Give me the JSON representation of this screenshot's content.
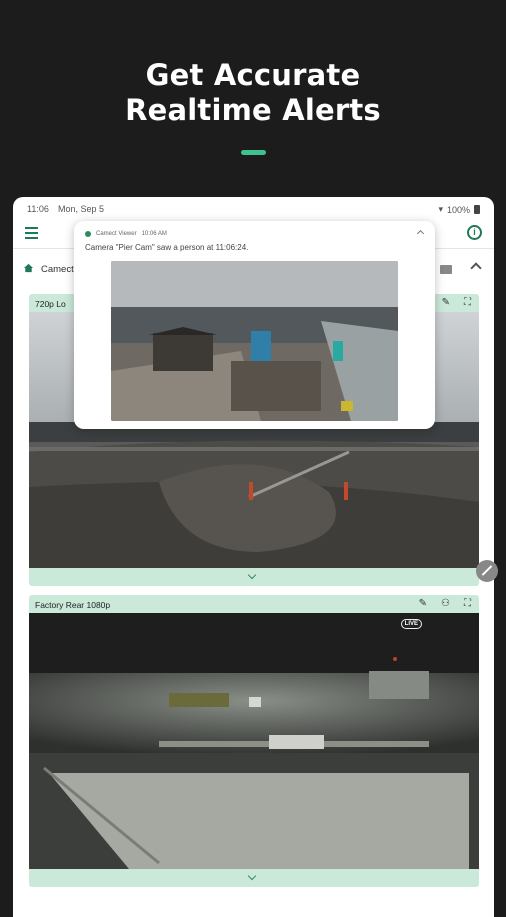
{
  "promo": {
    "headline_line1": "Get Accurate",
    "headline_line2": "Realtime Alerts",
    "accent_color": "#3ec28f"
  },
  "statusbar": {
    "time": "11:06",
    "date": "Mon, Sep 5",
    "battery": "100%"
  },
  "appbar": {
    "menu_icon": "hamburger-menu-icon",
    "info_icon": "info-icon"
  },
  "location": {
    "label": "Camect",
    "home_icon": "home-icon"
  },
  "notification": {
    "app_name": "Camect Viewer",
    "time": "10:06 AM",
    "message": "Camera \"Pier Cam\" saw a person at 11:06:24."
  },
  "cameras": [
    {
      "name": "720p Lo",
      "tools": [
        "pencil-icon",
        "expand-icon"
      ]
    },
    {
      "name": "Factory Rear 1080p",
      "live_badge": "LIVE",
      "tools": [
        "pencil-icon",
        "person-add-icon",
        "expand-icon"
      ]
    }
  ]
}
